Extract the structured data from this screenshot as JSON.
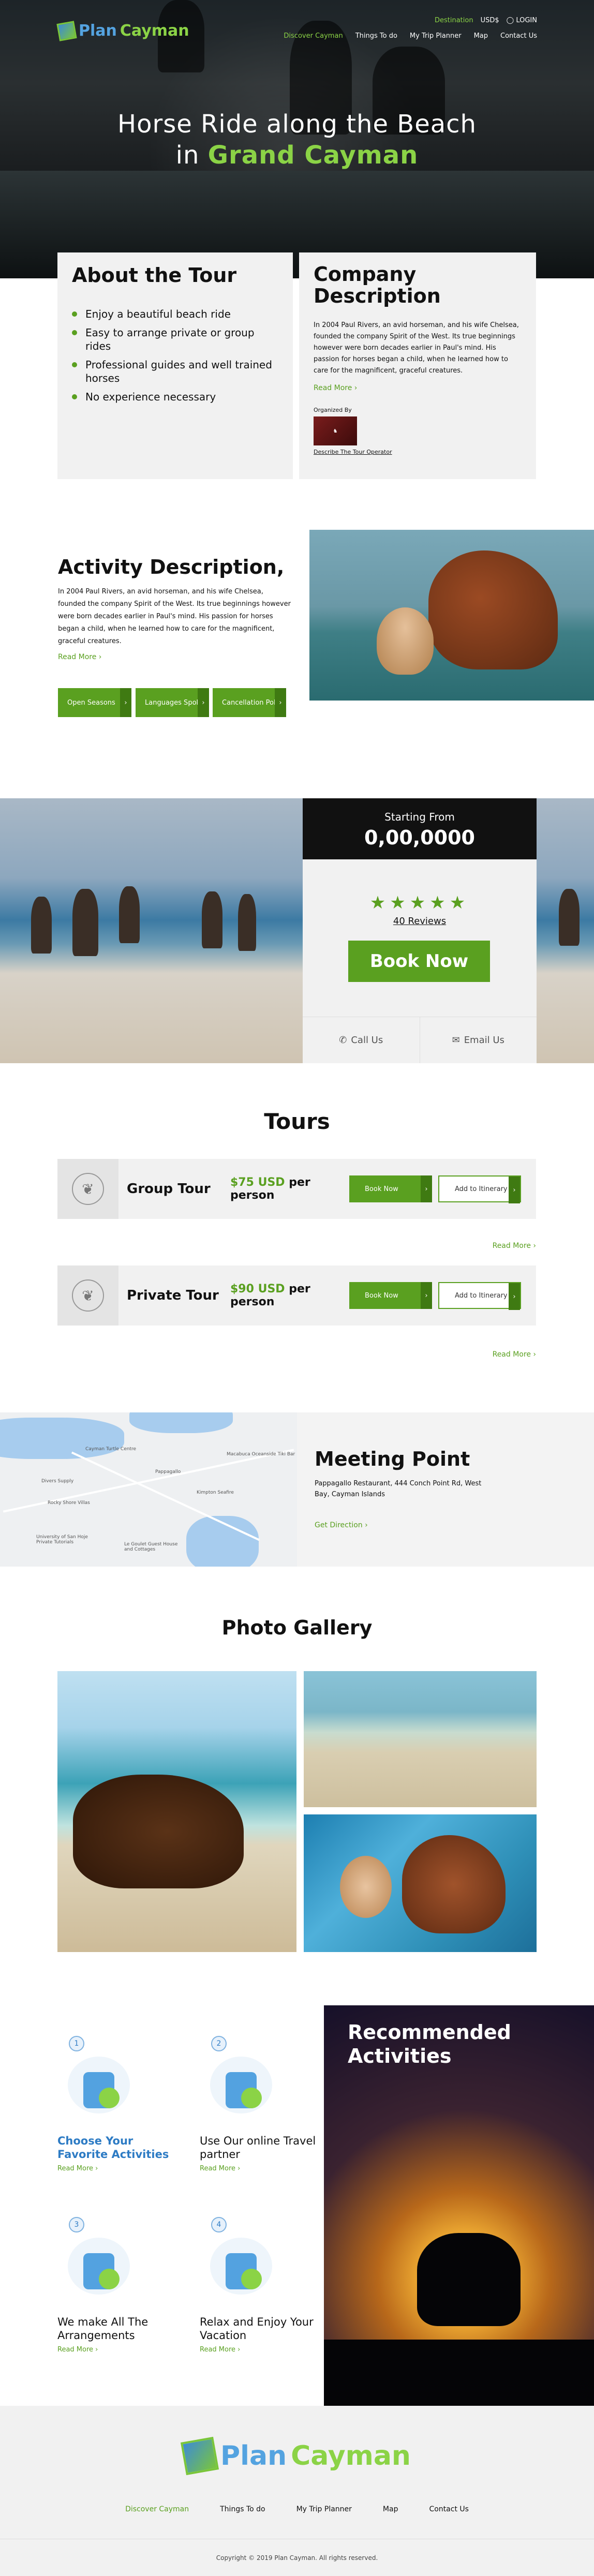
{
  "brand": {
    "name_part1": "Plan",
    "name_part2": "Cayman"
  },
  "header": {
    "top_links": [
      "Destination",
      "USD$",
      "LOGIN"
    ],
    "nav": [
      "Discover Cayman",
      "Things To do",
      "My Trip Planner",
      "Map",
      "Contact Us"
    ]
  },
  "hero": {
    "title_line1": "Horse Ride along the Beach",
    "title_line2_pre": "in ",
    "title_line2_highlight": "Grand Cayman"
  },
  "about": {
    "title": "About the Tour",
    "bullets": [
      "Enjoy a beautiful beach ride",
      "Easy to arrange private or group rides",
      "Professional guides and well trained horses",
      "No experience necessary"
    ]
  },
  "company": {
    "title": "Company Description",
    "text": "In 2004 Paul Rivers, an avid horseman, and his wife Chelsea, founded the company Spirit of the West. Its true beginnings however were born decades earlier in Paul's mind. His passion for horses began a child, when he learned how to care for the magnificent, graceful creatures.",
    "read_more": "Read More",
    "organized_by": "Organized By",
    "describe_operator": "Describe The Tour Operator"
  },
  "activity": {
    "title": "Activity Description,",
    "text": "In 2004 Paul Rivers, an avid horseman, and his wife Chelsea, founded the company Spirit of the West. Its true beginnings however were born decades earlier in Paul's mind. His passion for horses began a child, when he learned how to care for the magnificent, graceful creatures.",
    "read_more": "Read More",
    "buttons": [
      "Open Seasons",
      "Languages Spoken",
      "Cancellation Policy"
    ]
  },
  "booking": {
    "starting_from": "Starting From",
    "price": "0,00,0000",
    "rating": 5,
    "reviews": "40 Reviews",
    "book_now": "Book Now",
    "call_us": "Call Us",
    "email_us": "Email Us"
  },
  "tours": {
    "title": "Tours",
    "items": [
      {
        "name": "Group Tour",
        "price": "$75 USD",
        "per": " per person",
        "book": "Book Now",
        "add": "Add to Itinerary",
        "read_more": "Read More"
      },
      {
        "name": "Private Tour",
        "price": "$90 USD",
        "per": " per person",
        "book": "Book Now",
        "add": "Add to Itinerary",
        "read_more": "Read More"
      }
    ]
  },
  "meeting": {
    "title": "Meeting Point",
    "address": "Pappagallo Restaurant, 444 Conch Point Rd, West Bay, Cayman Islands",
    "directions": "Get Direction",
    "map_labels": [
      "Cayman Turtle Centre",
      "Macabuca Oceanside Tiki Bar",
      "Divers Supply",
      "Rocky Shore Villas",
      "University of San Hoje Private Tutorials",
      "Pappagallo",
      "Kimpton Seafire",
      "Le Goulet Guest House and Cottages"
    ]
  },
  "gallery": {
    "title": "Photo Gallery"
  },
  "recommended": {
    "title": "Recommended Activities",
    "steps": [
      {
        "num": "1",
        "title": "Choose Your Favorite Activities",
        "read_more": "Read More"
      },
      {
        "num": "2",
        "title": "Use Our online Travel partner",
        "read_more": "Read More"
      },
      {
        "num": "3",
        "title": "We make All The Arrangements",
        "read_more": "Read More"
      },
      {
        "num": "4",
        "title": "Relax and Enjoy Your Vacation",
        "read_more": "Read More"
      }
    ]
  },
  "footer": {
    "nav": [
      "Discover Cayman",
      "Things To do",
      "My Trip Planner",
      "Map",
      "Contact Us"
    ],
    "copyright": "Copyright © 2019 Plan Cayman. All rights reserved."
  }
}
